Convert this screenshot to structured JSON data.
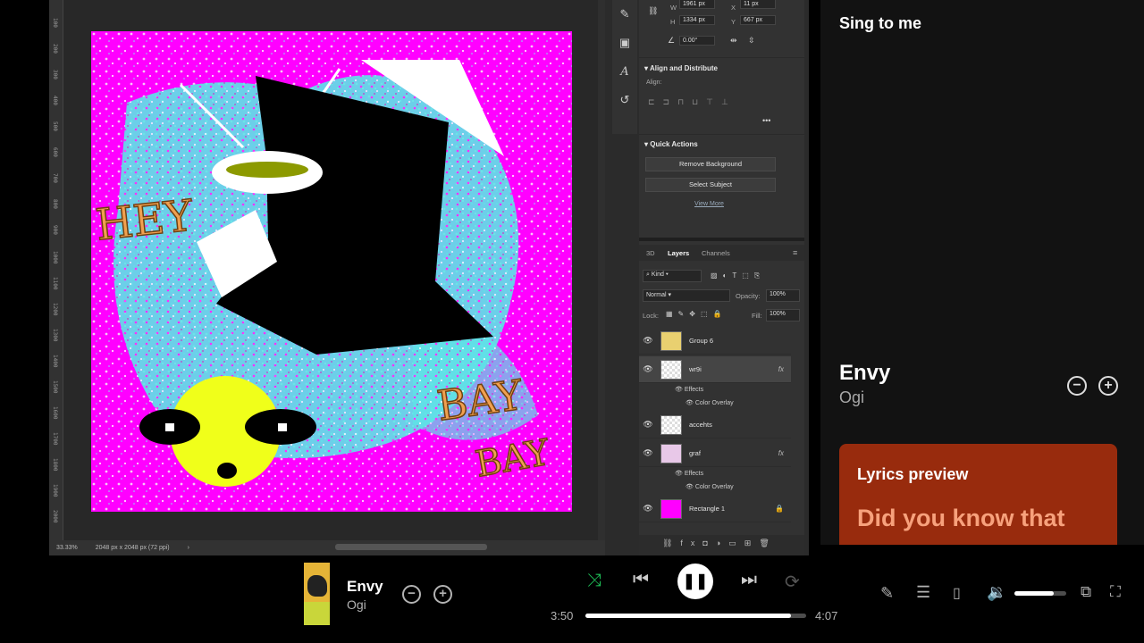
{
  "photoshop": {
    "status": {
      "zoom": "33.33%",
      "doc_info": "2048 px x 2048 px (72 ppi)"
    },
    "ruler_ticks": [
      "100",
      "200",
      "300",
      "400",
      "500",
      "600",
      "700",
      "800",
      "900",
      "1000",
      "1100",
      "1200",
      "1300",
      "1400",
      "1500",
      "1600",
      "1700",
      "1800",
      "1900",
      "2000"
    ],
    "artwork": {
      "text_hey": "HEY",
      "text_bay1": "BAY",
      "text_bay2": "BAY"
    },
    "properties": {
      "w_label": "W",
      "w_value": "1961 px",
      "h_label": "H",
      "h_value": "1334 px",
      "x_label": "X",
      "x_value": "11 px",
      "y_label": "Y",
      "y_value": "667 px",
      "angle_value": "0.00°"
    },
    "align": {
      "header": "Align and Distribute",
      "label": "Align:"
    },
    "quick_actions": {
      "header": "Quick Actions",
      "remove_bg": "Remove Background",
      "select_subject": "Select Subject",
      "view_more": "View More"
    },
    "layers_panel": {
      "tabs": [
        "3D",
        "Layers",
        "Channels"
      ],
      "kind_label": "Kind",
      "blend_mode": "Normal",
      "opacity_label": "Opacity:",
      "opacity_value": "100%",
      "lock_label": "Lock:",
      "fill_label": "Fill:",
      "fill_value": "100%",
      "layers": [
        {
          "name": "Group 6"
        },
        {
          "name": "wr9i"
        },
        {
          "name": "accehts"
        },
        {
          "name": "graf"
        },
        {
          "name": "Rectangle 1"
        }
      ],
      "effects_label": "Effects",
      "color_overlay_label": "Color Overlay",
      "fx_label": "fx"
    }
  },
  "sidebar": {
    "title": "Sing to me",
    "now_playing": {
      "title": "Envy",
      "artist": "Ogi"
    },
    "lyrics": {
      "header": "Lyrics preview",
      "line": "Did you know that"
    }
  },
  "player": {
    "track_title": "Envy",
    "track_artist": "Ogi",
    "elapsed": "3:50",
    "total": "4:07",
    "progress_fraction": 0.93,
    "volume_fraction": 0.75,
    "shuffle_color": "#1db954"
  },
  "colors": {
    "magenta": "#ff00ff",
    "cyan": "#5ce6e6",
    "lyrics_bg": "#982b0d",
    "lyrics_text": "#f7a17c"
  }
}
